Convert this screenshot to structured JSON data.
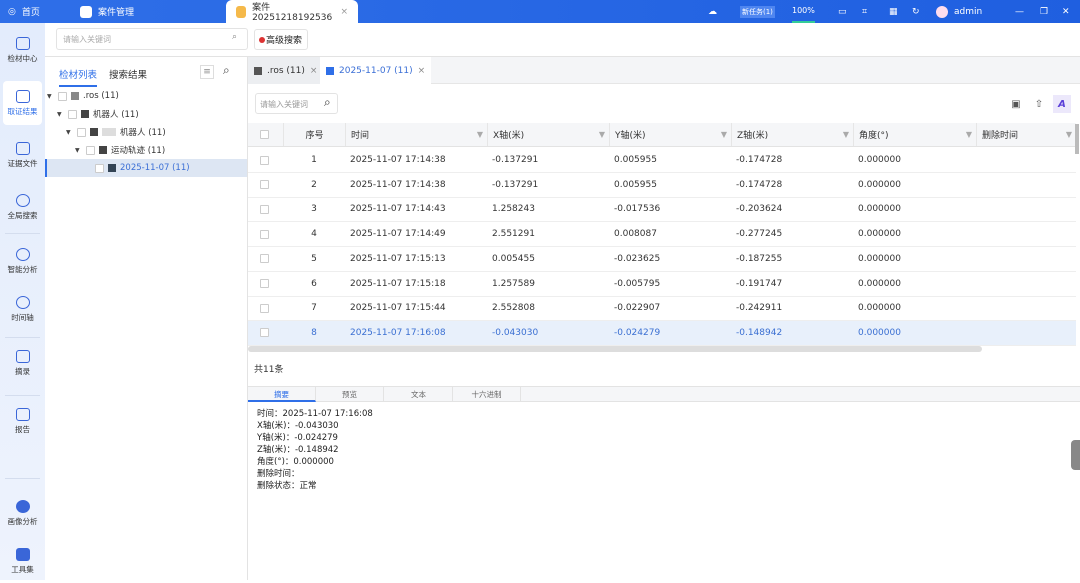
{
  "topbar": {
    "home": "首页",
    "tab_case_mgmt": "案件管理",
    "tab_case": "案件20251218192536",
    "close": "×",
    "task_badge": "新任务(1)",
    "zoom": "100%",
    "user": "admin",
    "min": "—",
    "restore": "❐",
    "close_win": "✕"
  },
  "nav": [
    {
      "label": "检材中心"
    },
    {
      "label": "取证结果"
    },
    {
      "label": "证据文件"
    },
    {
      "label": "全局搜索"
    },
    {
      "label": "智能分析"
    },
    {
      "label": "时间轴"
    },
    {
      "label": "摘录"
    },
    {
      "label": "报告"
    },
    {
      "label": "画像分析"
    },
    {
      "label": "工具集"
    }
  ],
  "search": {
    "placeholder": "请输入关键词",
    "advanced": "高级搜索"
  },
  "panel": {
    "tab_list": "检材列表",
    "tab_results": "搜索结果"
  },
  "tree": [
    {
      "label": ".ros (11)"
    },
    {
      "label": "机器人 (11)"
    },
    {
      "label": "机器人 (11)"
    },
    {
      "label": "运动轨迹 (11)"
    },
    {
      "label": "2025-11-07 (11)"
    }
  ],
  "doc_tabs": [
    {
      "label": ".ros (11)"
    },
    {
      "label": "2025-11-07 (11)"
    }
  ],
  "table_search_placeholder": "请输入关键词",
  "columns": [
    "序号",
    "时间",
    "X轴(米)",
    "Y轴(米)",
    "Z轴(米)",
    "角度(°)",
    "删除时间"
  ],
  "rows": [
    [
      "1",
      "2025-11-07 17:14:38",
      "-0.137291",
      "0.005955",
      "-0.174728",
      "0.000000",
      ""
    ],
    [
      "2",
      "2025-11-07 17:14:38",
      "-0.137291",
      "0.005955",
      "-0.174728",
      "0.000000",
      ""
    ],
    [
      "3",
      "2025-11-07 17:14:43",
      "1.258243",
      "-0.017536",
      "-0.203624",
      "0.000000",
      ""
    ],
    [
      "4",
      "2025-11-07 17:14:49",
      "2.551291",
      "0.008087",
      "-0.277245",
      "0.000000",
      ""
    ],
    [
      "5",
      "2025-11-07 17:15:13",
      "0.005455",
      "-0.023625",
      "-0.187255",
      "0.000000",
      ""
    ],
    [
      "6",
      "2025-11-07 17:15:18",
      "1.257589",
      "-0.005795",
      "-0.191747",
      "0.000000",
      ""
    ],
    [
      "7",
      "2025-11-07 17:15:44",
      "2.552808",
      "-0.022907",
      "-0.242911",
      "0.000000",
      ""
    ],
    [
      "8",
      "2025-11-07 17:16:08",
      "-0.043030",
      "-0.024279",
      "-0.148942",
      "0.000000",
      ""
    ]
  ],
  "total": "共11条",
  "bottom_tabs": [
    "摘要",
    "预览",
    "文本",
    "十六进制"
  ],
  "detail": [
    "时间：2025-11-07 17:16:08",
    "X轴(米)：-0.043030",
    "Y轴(米)：-0.024279",
    "Z轴(米)：-0.148942",
    "角度(°)：0.000000",
    "删除时间：",
    "删除状态：正常"
  ],
  "colors": {
    "accent": "#2f6fe8",
    "selected_row": "#e8f0fb"
  }
}
